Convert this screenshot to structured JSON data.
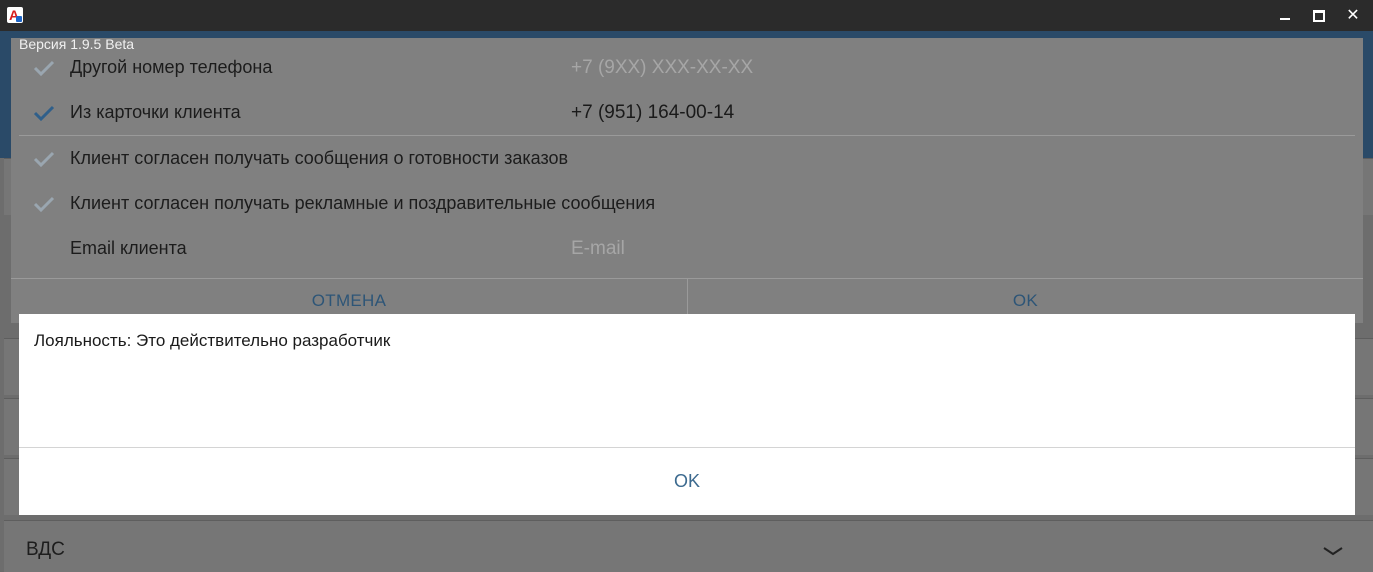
{
  "window": {
    "icon": "app-logo-icon",
    "controls": [
      "minimize-icon",
      "maximize-icon",
      "close-icon"
    ]
  },
  "version_label": "Версия 1.9.5 Beta",
  "phone_dialog": {
    "options": [
      {
        "label": "Другой номер телефона",
        "value": "+7 (9XX) XXX-XX-XX",
        "checked": false,
        "value_is_placeholder": true
      },
      {
        "label": "Из карточки клиента",
        "value": "+7 (951) 164-00-14",
        "checked": true,
        "value_is_placeholder": false
      }
    ],
    "consents": [
      {
        "label": "Клиент согласен получать сообщения о готовности заказов",
        "checked": false
      },
      {
        "label": "Клиент согласен получать рекламные и поздравительные сообщения",
        "checked": false
      }
    ],
    "email": {
      "label": "Email клиента",
      "placeholder": "E-mail"
    },
    "cancel_label": "ОТМЕНА",
    "ok_label": "OK"
  },
  "alert": {
    "message": "Лояльность: Это действительно разработчик",
    "ok_label": "OK"
  },
  "background": {
    "section_label": "ВДС"
  },
  "colors": {
    "accent_blue": "#2d5577",
    "check_active": "#2f5f8a",
    "check_inactive": "#9aa6b0"
  }
}
